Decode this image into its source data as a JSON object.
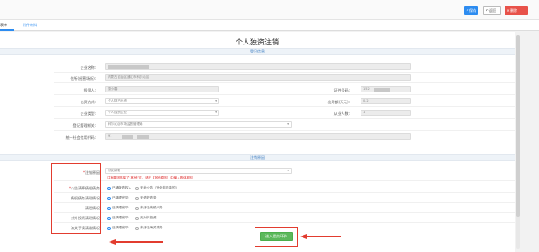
{
  "toolbar": {
    "save_label": "保存",
    "back_label": "返回",
    "delete_label": "删除",
    "save_icon": "check-icon",
    "back_icon": "return-icon",
    "delete_icon": "close-icon"
  },
  "tabs": [
    {
      "label": "表单"
    },
    {
      "label": "附件材料"
    }
  ],
  "page_title": "个人独资注销",
  "sections": {
    "registration": "登记信息",
    "cancellation": "注销原因"
  },
  "registration": {
    "enterprise_name": {
      "label": "企业名称:",
      "value": ""
    },
    "address": {
      "label": "住所(经营场所):",
      "value": "内蒙古自治区通辽市科尔沁区"
    },
    "investor": {
      "label": "投资人:",
      "value": "张小春"
    },
    "id_number": {
      "label": "证件号码:",
      "value": "152"
    },
    "contribution_method": {
      "label": "出资方式:",
      "value": "个人财产出资"
    },
    "contribution_amount": {
      "label": "出资额(万元):",
      "value": "0.2"
    },
    "enterprise_type": {
      "label": "企业类型:",
      "value": "个人独资企业"
    },
    "employees": {
      "label": "从业人数:",
      "value": "1"
    },
    "registration_authority": {
      "label": "登记管理机关:",
      "value": "科尔沁区市场监督管理局"
    },
    "credit_code": {
      "label": "统一社会信用代码:",
      "value": "91"
    }
  },
  "cancellation": {
    "reason": {
      "label": "注销原因",
      "required_mark": "*",
      "value": "决议解散",
      "hint": "注销原因选择了“其他”时，请在【其他原因】中输入具体原因"
    },
    "liquidation_clearance": {
      "label": "公告清算债权债务",
      "required_mark": "*",
      "options": [
        "已通报债权人",
        "无此公告（完全非现金的）"
      ],
      "selected": 0
    },
    "tax_clearance": {
      "label": "债权债务清理情况",
      "options": [
        "已清理完毕",
        "无债权债务"
      ],
      "selected": 0
    },
    "tax_settlement": {
      "label": "清税情况",
      "options": [
        "已清理完毕",
        "未涉及纳税义务"
      ],
      "selected": 0
    },
    "foreign_investment": {
      "label": "对外投资清理情况",
      "options": [
        "已清理完毕",
        "无对外投资"
      ],
      "selected": 0
    },
    "customs_clearance": {
      "label": "海关手续清缴情况",
      "options": [
        "已清理完毕",
        "未涉及海关事务"
      ],
      "selected": 0
    }
  },
  "submit_label": "进入提交环节",
  "colors": {
    "primary": "#2d8cf0",
    "danger": "#e8524a",
    "success": "#5cb85c",
    "annotation": "#e23c2f"
  }
}
